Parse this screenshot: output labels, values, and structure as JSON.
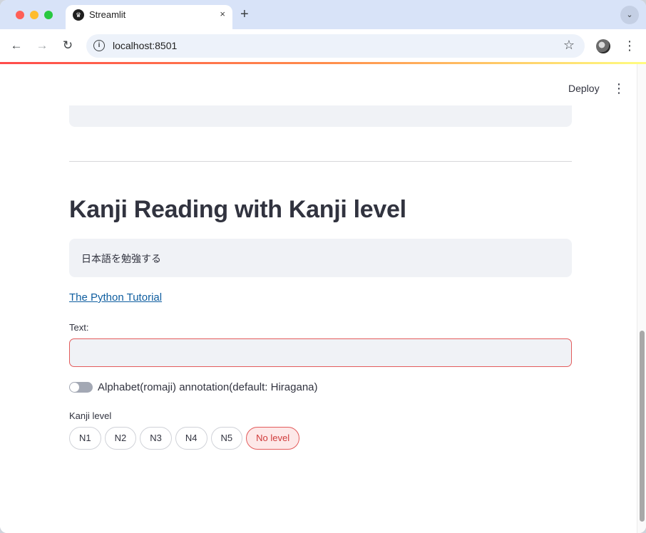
{
  "browser": {
    "tab_title": "Streamlit",
    "tab_close": "×",
    "new_tab": "+",
    "tab_menu": "⌄",
    "url": "localhost:8501",
    "back": "←",
    "forward": "→",
    "reload": "↻",
    "site_info": "i",
    "star": "☆",
    "menu": "⋮"
  },
  "app": {
    "deploy_label": "Deploy",
    "menu": "⋮",
    "title": "Kanji Reading with Kanji level",
    "info_text": "日本語を勉強する",
    "link_text": "The Python Tutorial",
    "text_label": "Text:",
    "text_value": "",
    "toggle_label": "Alphabet(romaji) annotation(default: Hiragana)",
    "toggle_on": false,
    "level_label": "Kanji level",
    "levels": [
      "N1",
      "N2",
      "N3",
      "N4",
      "N5",
      "No level"
    ],
    "selected_level": "No level"
  },
  "colors": {
    "accent": "#ff4b4b",
    "link": "#0f5ea0",
    "text": "#31333f",
    "panel": "#f0f2f6"
  }
}
